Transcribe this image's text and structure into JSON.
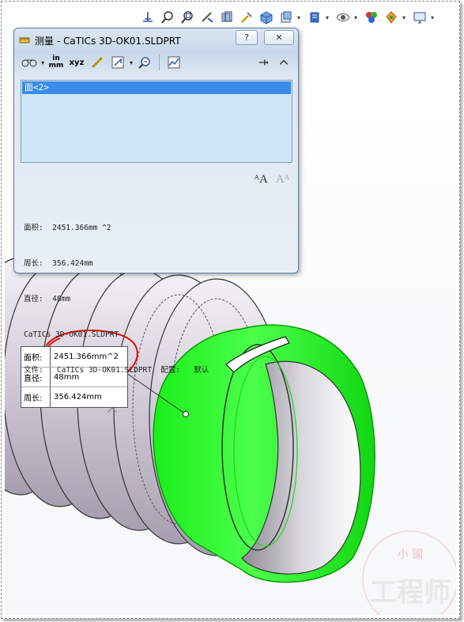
{
  "dialog": {
    "title": "测量 - CaTICs 3D-OK01.SLDPRT",
    "help_label": "?",
    "close_label": "✕",
    "toolbar": {
      "units_label": "in mm",
      "xyz_label": "xyz"
    },
    "selection": [
      "面<2>"
    ],
    "results": [
      "面积:  2451.366mm ^2",
      "周长:  356.424mm",
      "直径:  48mm",
      "CaTICs 3D-OK01.SLDPRT",
      "文件:   CaTICs 3D-OK01.SLDPRT  配置:   默认"
    ]
  },
  "callout": {
    "area_label": "面积:",
    "area_value": "2451.366mm^2",
    "diameter_label": "直径:",
    "diameter_value": "48mm",
    "perimeter_label": "周长:",
    "perimeter_value": "356.424mm"
  },
  "watermark": {
    "top_text": "小 國",
    "bottom_text": "工程师"
  },
  "colors": {
    "selected_face": "#1cf21c",
    "part_body": "#e8e4ee",
    "annotation_circle": "#e01010"
  }
}
